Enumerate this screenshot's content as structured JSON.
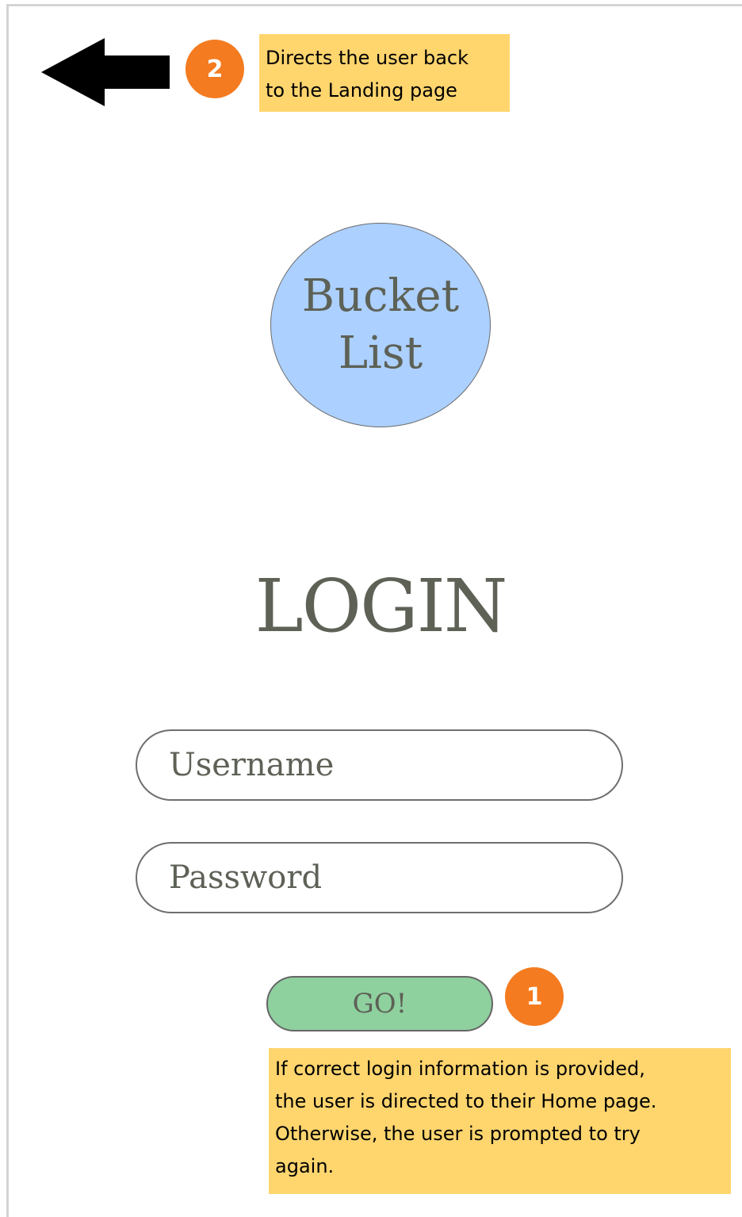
{
  "back": {
    "icon": "left-arrow-icon",
    "badge": "2",
    "note": "Directs the user back\nto the Landing page"
  },
  "logo": {
    "text": "Bucket\nList",
    "fill": "#acd0ff"
  },
  "title": "LOGIN",
  "form": {
    "username_placeholder": "Username",
    "password_placeholder": "Password",
    "submit_label": "GO!",
    "submit_color": "#8fd09f"
  },
  "submit_note": {
    "badge": "1",
    "note": "If correct login information is provided,\nthe user is directed to their Home page.\nOtherwise, the user is prompted to try\nagain."
  },
  "colors": {
    "badge": "#f47b20",
    "note": "#ffd56e",
    "text": "#5d6156"
  }
}
